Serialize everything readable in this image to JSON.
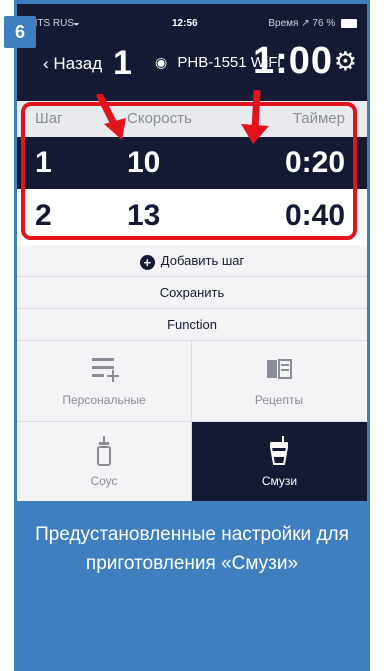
{
  "step_badge": "6",
  "status_bar": {
    "carrier": "MTS RUS",
    "time": "12:56",
    "right": "Время",
    "battery": "76 %"
  },
  "header": {
    "back_label": "Назад",
    "big_number": "1",
    "device": "PHB-1551",
    "device_suffix": "WiFi",
    "timer": "1:00"
  },
  "table": {
    "columns": [
      "Шаг",
      "Скорость",
      "Таймер"
    ],
    "rows": [
      {
        "step": "1",
        "speed": "10",
        "timer": "0:20"
      },
      {
        "step": "2",
        "speed": "13",
        "timer": "0:40"
      }
    ]
  },
  "actions": {
    "add_step": "Добавить шаг",
    "save": "Сохранить",
    "function": "Function"
  },
  "modes": [
    {
      "label": "Персональные",
      "icon": "list-add-icon"
    },
    {
      "label": "Рецепты",
      "icon": "recipe-book-icon"
    },
    {
      "label": "Соус",
      "icon": "sauce-bottle-icon"
    },
    {
      "label": "Смузи",
      "icon": "smoothie-cup-icon"
    }
  ],
  "caption": "Предустановленные настройки для приготовления «Смузи»",
  "colors": {
    "dark": "#141a34",
    "accent": "#3f7fc0",
    "highlight": "#e1141b"
  }
}
